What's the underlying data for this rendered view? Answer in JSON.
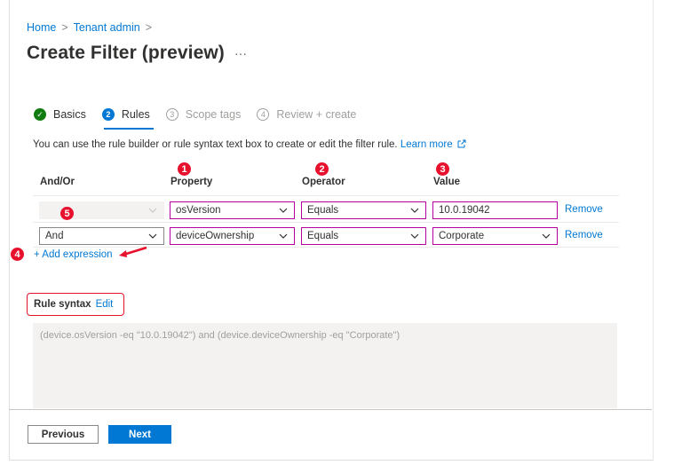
{
  "breadcrumb": {
    "home": "Home",
    "tenant": "Tenant admin",
    "sep": ">"
  },
  "page": {
    "title": "Create Filter (preview)",
    "more": "···"
  },
  "steps": [
    {
      "num": "✓",
      "label": "Basics",
      "state": "done"
    },
    {
      "num": "2",
      "label": "Rules",
      "state": "active"
    },
    {
      "num": "3",
      "label": "Scope tags",
      "state": "todo"
    },
    {
      "num": "4",
      "label": "Review + create",
      "state": "todo"
    }
  ],
  "description": {
    "text": "You can use the rule builder or rule syntax text box to create or edit the filter rule. ",
    "link": "Learn more"
  },
  "table": {
    "headers": {
      "andor": "And/Or",
      "property": "Property",
      "operator": "Operator",
      "value": "Value"
    },
    "rows": [
      {
        "andor": "",
        "property": "osVersion",
        "operator": "Equals",
        "value": "10.0.19042",
        "remove": "Remove"
      },
      {
        "andor": "And",
        "property": "deviceOwnership",
        "operator": "Equals",
        "value": "Corporate",
        "remove": "Remove"
      }
    ]
  },
  "annotations": {
    "n1": "1",
    "n2": "2",
    "n3": "3",
    "n4": "4",
    "n5": "5"
  },
  "add_expression": "+ Add expression",
  "rule_syntax": {
    "label": "Rule syntax",
    "edit": "Edit",
    "text": "(device.osVersion -eq \"10.0.19042\") and (device.deviceOwnership -eq \"Corporate\")"
  },
  "buttons": {
    "previous": "Previous",
    "next": "Next"
  },
  "colors": {
    "accent": "#0078d4",
    "annotation": "#e8112d",
    "highlight": "#b4009e",
    "success": "#107c10"
  }
}
